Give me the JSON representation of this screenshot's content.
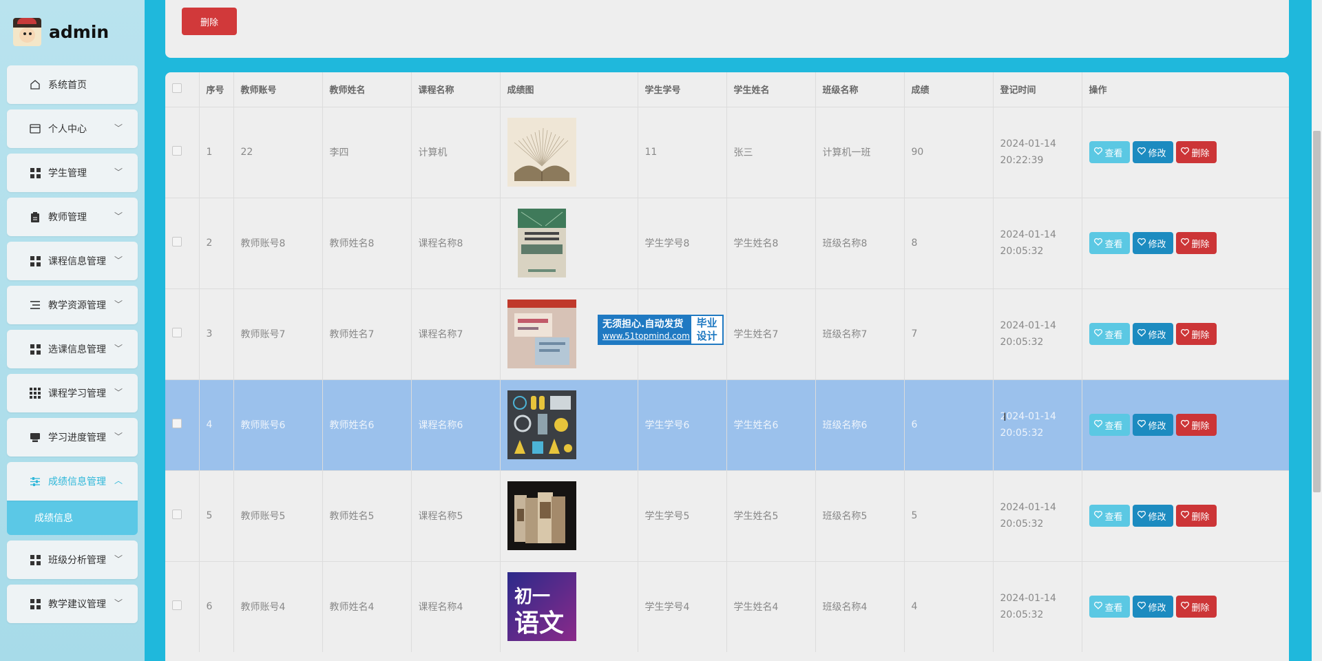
{
  "brand": {
    "name": "admin"
  },
  "menu": [
    {
      "label": "系统首页",
      "icon": "home-icon"
    },
    {
      "label": "个人中心",
      "icon": "card-icon"
    },
    {
      "label": "学生管理",
      "icon": "grid-icon"
    },
    {
      "label": "教师管理",
      "icon": "clipboard-icon"
    },
    {
      "label": "课程信息管理",
      "icon": "grid-icon"
    },
    {
      "label": "教学资源管理",
      "icon": "list-icon"
    },
    {
      "label": "选课信息管理",
      "icon": "grid-icon"
    },
    {
      "label": "课程学习管理",
      "icon": "grid9-icon"
    },
    {
      "label": "学习进度管理",
      "icon": "printer-icon"
    },
    {
      "label": "成绩信息管理",
      "icon": "sliders-icon",
      "open": true,
      "sub": "成绩信息"
    },
    {
      "label": "班级分析管理",
      "icon": "grid-icon"
    },
    {
      "label": "教学建议管理",
      "icon": "grid-icon"
    }
  ],
  "toolbar": {
    "delete_label": "删除"
  },
  "table": {
    "headers": [
      "序号",
      "教师账号",
      "教师姓名",
      "课程名称",
      "成绩图",
      "学生学号",
      "学生姓名",
      "班级名称",
      "成绩",
      "登记时间",
      "操作"
    ],
    "rows": [
      {
        "no": "1",
        "teacher_account": "22",
        "teacher_name": "李四",
        "course": "计算机",
        "image": "book-pages",
        "student_no": "11",
        "student_name": "张三",
        "class_name": "计算机一班",
        "score": "90",
        "time": "2024-01-14 20:22:39"
      },
      {
        "no": "2",
        "teacher_account": "教师账号8",
        "teacher_name": "教师姓名8",
        "course": "课程名称8",
        "image": "textbook-cover",
        "student_no": "学生学号8",
        "student_name": "学生姓名8",
        "class_name": "班级名称8",
        "score": "8",
        "time": "2024-01-14 20:05:32"
      },
      {
        "no": "3",
        "teacher_account": "教师账号7",
        "teacher_name": "教师姓名7",
        "course": "课程名称7",
        "image": "study-guide",
        "student_no": "",
        "student_name": "学生姓名7",
        "class_name": "班级名称7",
        "score": "7",
        "time": "2024-01-14 20:05:32"
      },
      {
        "no": "4",
        "teacher_account": "教师账号6",
        "teacher_name": "教师姓名6",
        "course": "课程名称6",
        "image": "science-icons",
        "student_no": "学生学号6",
        "student_name": "学生姓名6",
        "class_name": "班级名称6",
        "score": "6",
        "time": "2024-01-14 20:05:32",
        "selected": true
      },
      {
        "no": "5",
        "teacher_account": "教师账号5",
        "teacher_name": "教师姓名5",
        "course": "课程名称5",
        "image": "book-set",
        "student_no": "学生学号5",
        "student_name": "学生姓名5",
        "class_name": "班级名称5",
        "score": "5",
        "time": "2024-01-14 20:05:32"
      },
      {
        "no": "6",
        "teacher_account": "教师账号4",
        "teacher_name": "教师姓名4",
        "course": "课程名称4",
        "image": "chinese-cover",
        "student_no": "学生学号4",
        "student_name": "学生姓名4",
        "class_name": "班级名称4",
        "score": "4",
        "time": "2024-01-14 20:05:32"
      }
    ],
    "actions": {
      "view": "查看",
      "edit": "修改",
      "delete": "删除"
    }
  },
  "thumb_text": {
    "chinese_cover": "初一 语文"
  },
  "watermark": {
    "line1": "无须担心.自动发货",
    "line2": "www.51topmind.com",
    "badge_top": "毕业",
    "badge_bottom": "设计"
  },
  "colors": {
    "accent": "#2fb7d9",
    "delete": "#cc3537",
    "edit": "#1c8bc0",
    "view": "#5bc8e3",
    "selected_row": "#9bc1ec"
  }
}
